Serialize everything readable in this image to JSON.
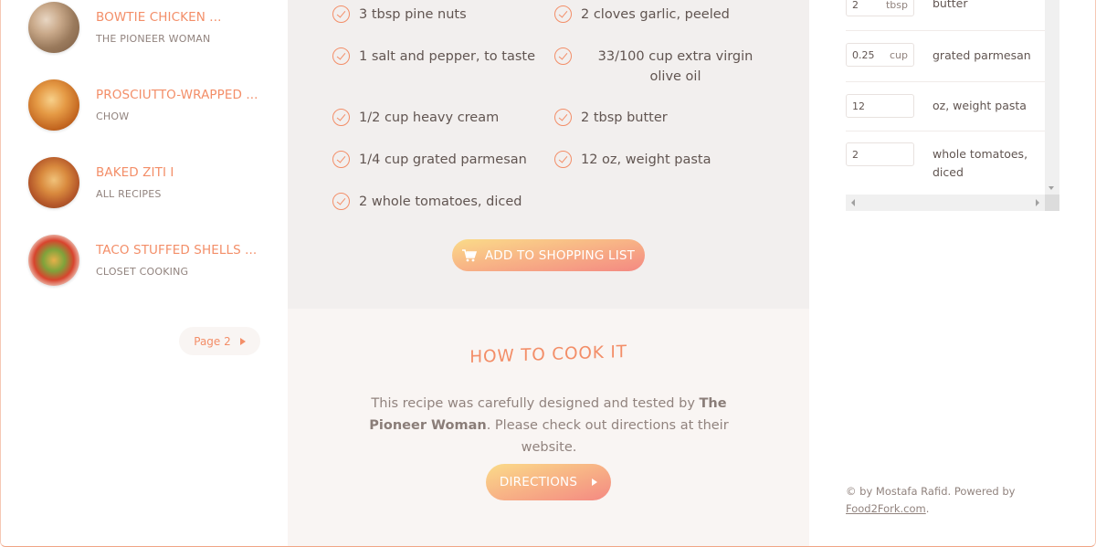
{
  "results": [
    {
      "title": "BOWTIE CHICKEN ...",
      "publisher": "THE PIONEER WOMAN"
    },
    {
      "title": "PROSCIUTTO-WRAPPED ...",
      "publisher": "CHOW"
    },
    {
      "title": "BAKED ZITI I",
      "publisher": "ALL RECIPES"
    },
    {
      "title": "TACO STUFFED SHELLS ...",
      "publisher": "CLOSET COOKING"
    }
  ],
  "pagination": {
    "next_label": "Page 2"
  },
  "ingredients": [
    "3 tbsp pine nuts",
    "2 cloves garlic, peeled",
    "1 salt and pepper, to taste",
    "33/100 cup extra virgin olive oil",
    "1/2 cup heavy cream",
    "2 tbsp butter",
    "1/4 cup grated parmesan",
    "12 oz, weight pasta",
    "2 whole tomatoes, diced"
  ],
  "add_to_list_label": "ADD TO SHOPPING LIST",
  "directions": {
    "heading": "HOW TO COOK IT",
    "text_before": "This recipe was carefully designed and tested by ",
    "publisher": "The Pioneer Woman",
    "text_after": ". Please check out directions at their website.",
    "button_label": "DIRECTIONS"
  },
  "shopping_list": [
    {
      "count": "2",
      "unit": "tbsp",
      "description": "butter"
    },
    {
      "count": "0.25",
      "unit": "cup",
      "description": "grated parmesan"
    },
    {
      "count": "12",
      "unit": "",
      "description": "oz, weight pasta"
    },
    {
      "count": "2",
      "unit": "",
      "description": "whole tomatoes, diced"
    }
  ],
  "footer": {
    "text": "© by Mostafa Rafid. Powered by",
    "link_label": "Food2Fork.com",
    "suffix": "."
  },
  "colors": {
    "accent": "#f38e68",
    "gradient_start": "#fbdb89",
    "gradient_end": "#f48982",
    "text": "#615551",
    "muted": "#91837e"
  }
}
